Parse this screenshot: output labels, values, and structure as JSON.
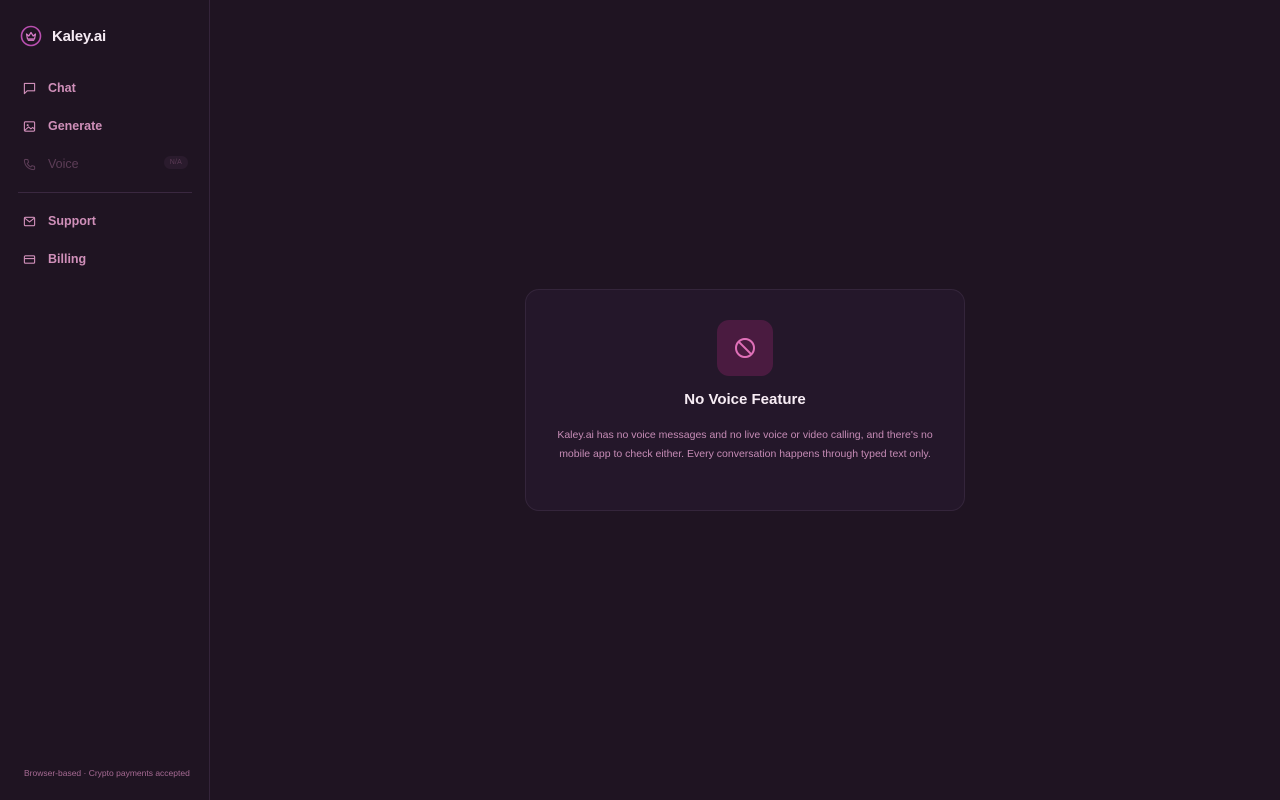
{
  "brand": {
    "name": "Kaley.ai",
    "logo_icon": "crown-circle-icon"
  },
  "sidebar": {
    "items": [
      {
        "label": "Chat",
        "icon": "message-square-icon",
        "enabled": true
      },
      {
        "label": "Generate",
        "icon": "image-icon",
        "enabled": true
      },
      {
        "label": "Voice",
        "icon": "phone-icon",
        "enabled": false,
        "badge": "N/A"
      },
      {
        "label": "Support",
        "icon": "mail-icon",
        "enabled": true
      },
      {
        "label": "Billing",
        "icon": "credit-card-icon",
        "enabled": true
      }
    ],
    "footer": "Browser-based · Crypto payments accepted"
  },
  "main": {
    "card": {
      "icon": "ban-icon",
      "title": "No Voice Feature",
      "text": "Kaley.ai has no voice messages and no live voice or video calling, and there's no mobile app to check either. Every conversation happens through typed text only."
    }
  },
  "colors": {
    "background": "#1f1422",
    "card": "#24172a",
    "accent": "#e070b8",
    "icon_tile": "#4a1b40"
  }
}
